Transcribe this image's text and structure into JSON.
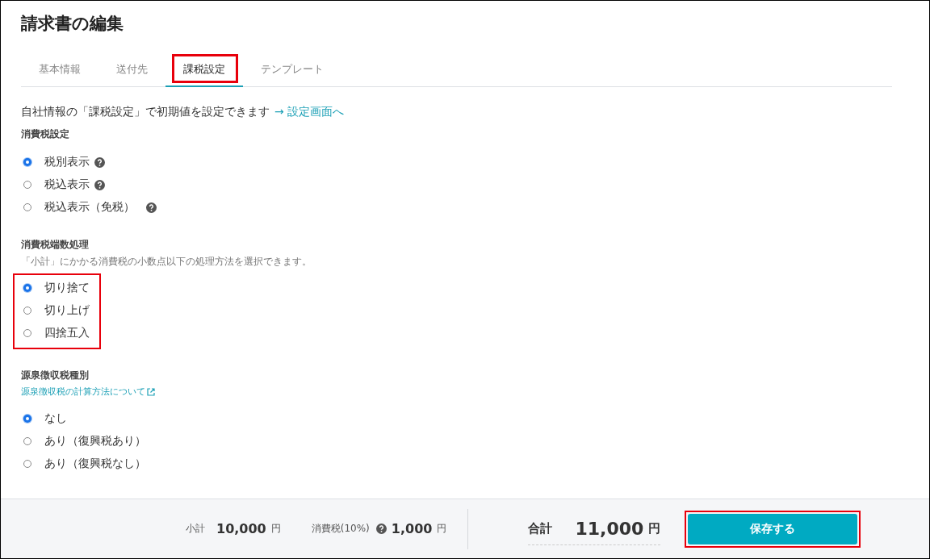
{
  "title": "請求書の編集",
  "tabs": [
    {
      "label": "基本情報",
      "selected": false,
      "highlighted": false
    },
    {
      "label": "送付先",
      "selected": false,
      "highlighted": false
    },
    {
      "label": "課税設定",
      "selected": true,
      "highlighted": true
    },
    {
      "label": "テンプレート",
      "selected": false,
      "highlighted": false
    }
  ],
  "notice": {
    "text": "自社情報の「課税設定」で初期値を設定できます",
    "link": "→ 設定画面へ"
  },
  "sections": [
    {
      "heading": "消費税設定",
      "highlighted": false,
      "options": [
        {
          "label": "税別表示",
          "selected": true,
          "help": true
        },
        {
          "label": "税込表示",
          "selected": false,
          "help": true
        },
        {
          "label": "税込表示（免税）",
          "selected": false,
          "help": true
        }
      ]
    },
    {
      "heading": "消費税端数処理",
      "description": "「小計」にかかる消費税の小数点以下の処理方法を選択できます。",
      "highlighted": true,
      "options": [
        {
          "label": "切り捨て",
          "selected": true,
          "help": false
        },
        {
          "label": "切り上げ",
          "selected": false,
          "help": false
        },
        {
          "label": "四捨五入",
          "selected": false,
          "help": false
        }
      ]
    },
    {
      "heading": "源泉徴収税種別",
      "link": "源泉徴収税の計算方法について",
      "highlighted": false,
      "options": [
        {
          "label": "なし",
          "selected": true,
          "help": false
        },
        {
          "label": "あり（復興税あり）",
          "selected": false,
          "help": false
        },
        {
          "label": "あり（復興税なし）",
          "selected": false,
          "help": false
        }
      ]
    }
  ],
  "footer": {
    "subtotal_label": "小計",
    "subtotal": "10,000",
    "subtotal_unit": "円",
    "tax_label": "消費税(10%)",
    "tax": "1,000",
    "tax_unit": "円",
    "total_label": "合計",
    "total": "11,000",
    "total_unit": "円",
    "save": "保存する",
    "save_highlighted": true
  }
}
